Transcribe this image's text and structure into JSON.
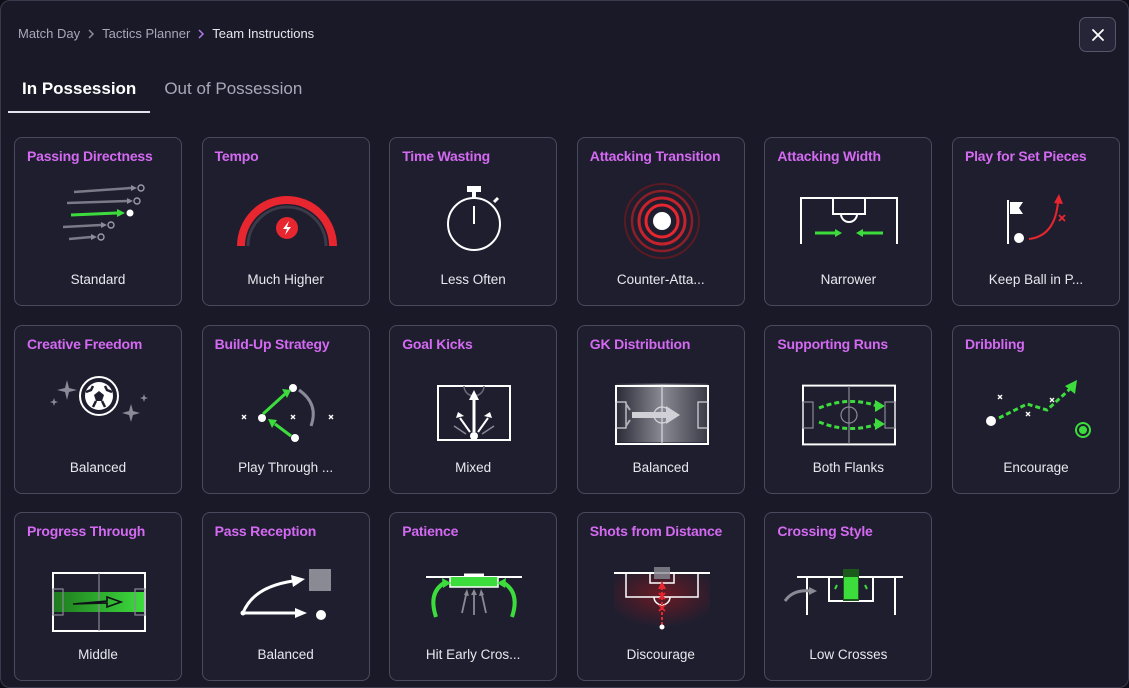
{
  "breadcrumb": {
    "items": [
      "Match Day",
      "Tactics Planner",
      "Team Instructions"
    ]
  },
  "tabs": [
    {
      "label": "In Possession",
      "active": true
    },
    {
      "label": "Out of Possession",
      "active": false
    }
  ],
  "close_icon": "close-icon",
  "colors": {
    "accent_title": "#d46af2",
    "green": "#3ddc3d",
    "red": "#e8262f",
    "card_bg": "#1f1e2f",
    "card_border": "#4a4a5e"
  },
  "cards": [
    {
      "title": "Passing Directness",
      "value": "Standard",
      "icon": "passing-directness-icon"
    },
    {
      "title": "Tempo",
      "value": "Much Higher",
      "icon": "tempo-gauge-icon"
    },
    {
      "title": "Time Wasting",
      "value": "Less Often",
      "icon": "stopwatch-icon"
    },
    {
      "title": "Attacking Transition",
      "value": "Counter-Atta...",
      "icon": "transition-rings-icon"
    },
    {
      "title": "Attacking Width",
      "value": "Narrower",
      "icon": "width-pitch-icon"
    },
    {
      "title": "Play for Set Pieces",
      "value": "Keep Ball in P...",
      "icon": "corner-flag-icon"
    },
    {
      "title": "Creative Freedom",
      "value": "Balanced",
      "icon": "creative-ball-icon"
    },
    {
      "title": "Build-Up Strategy",
      "value": "Play Through ...",
      "icon": "build-up-icon"
    },
    {
      "title": "Goal Kicks",
      "value": "Mixed",
      "icon": "goal-kicks-icon"
    },
    {
      "title": "GK Distribution",
      "value": "Balanced",
      "icon": "gk-distribution-icon"
    },
    {
      "title": "Supporting Runs",
      "value": "Both Flanks",
      "icon": "supporting-runs-icon"
    },
    {
      "title": "Dribbling",
      "value": "Encourage",
      "icon": "dribbling-icon"
    },
    {
      "title": "Progress Through",
      "value": "Middle",
      "icon": "progress-through-icon"
    },
    {
      "title": "Pass Reception",
      "value": "Balanced",
      "icon": "pass-reception-icon"
    },
    {
      "title": "Patience",
      "value": "Hit Early Cros...",
      "icon": "patience-icon"
    },
    {
      "title": "Shots from Distance",
      "value": "Discourage",
      "icon": "shots-distance-icon"
    },
    {
      "title": "Crossing Style",
      "value": "Low Crosses",
      "icon": "crossing-style-icon"
    }
  ]
}
